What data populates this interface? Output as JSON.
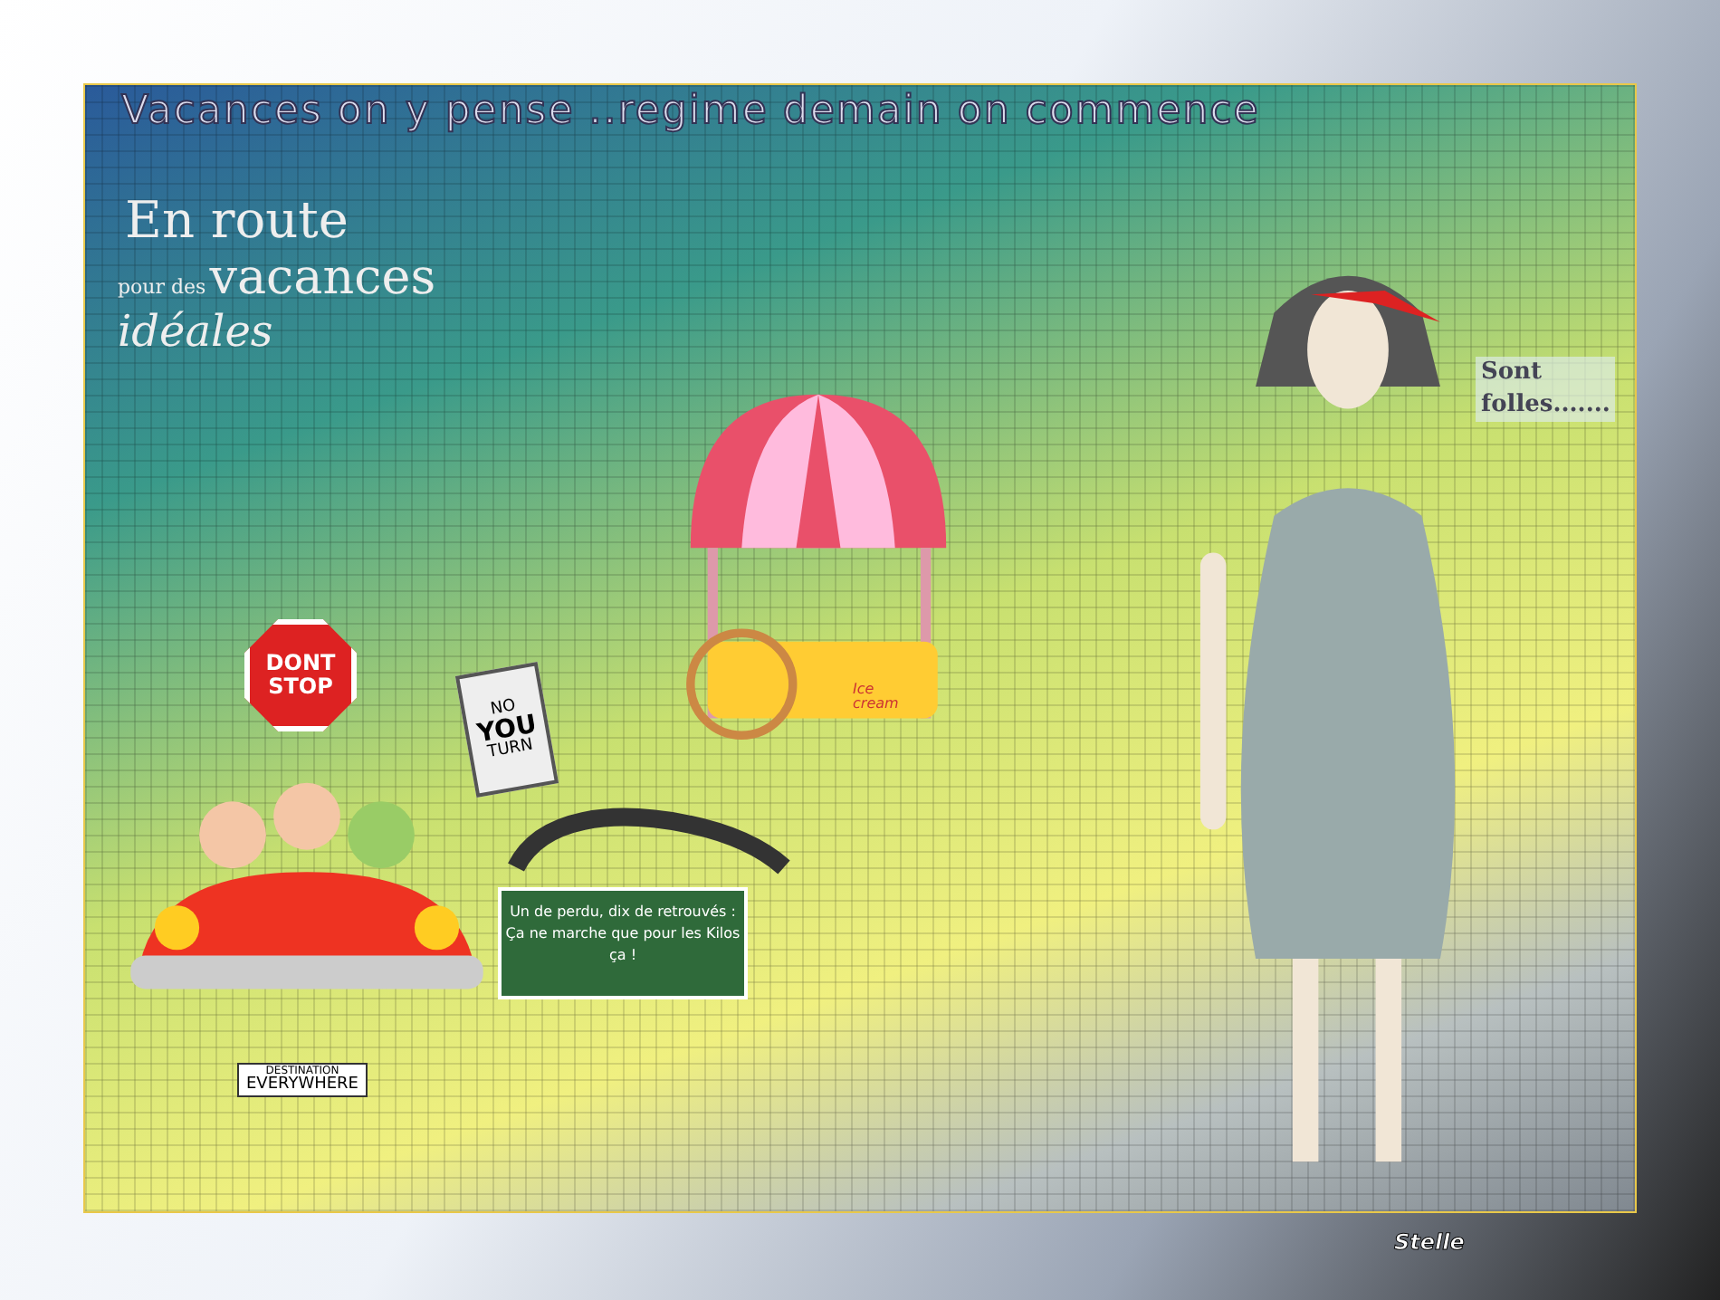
{
  "title": "Vacances on y pense ..regime  demain on commence",
  "logo": {
    "line_1": "En route",
    "line_2": "pour des",
    "line_3": "vacances",
    "line_4": "idéales"
  },
  "stop_sign": {
    "line_1": "DONT",
    "line_2": "STOP"
  },
  "turn_sign": {
    "line_1": "NO",
    "line_2": "YOU",
    "line_3": "TURN"
  },
  "cart": {
    "label_1": "Ice",
    "label_2": "cream"
  },
  "plate": {
    "line_1": "DESTINATION",
    "line_2": "EVERYWHERE"
  },
  "road_sign": {
    "text": "Un de perdu, dix de retrouvés : Ça ne marche que pour les Kilos ça !"
  },
  "caption": {
    "line_1": "Sont",
    "line_2": "folles......."
  },
  "signature": "Stelle"
}
